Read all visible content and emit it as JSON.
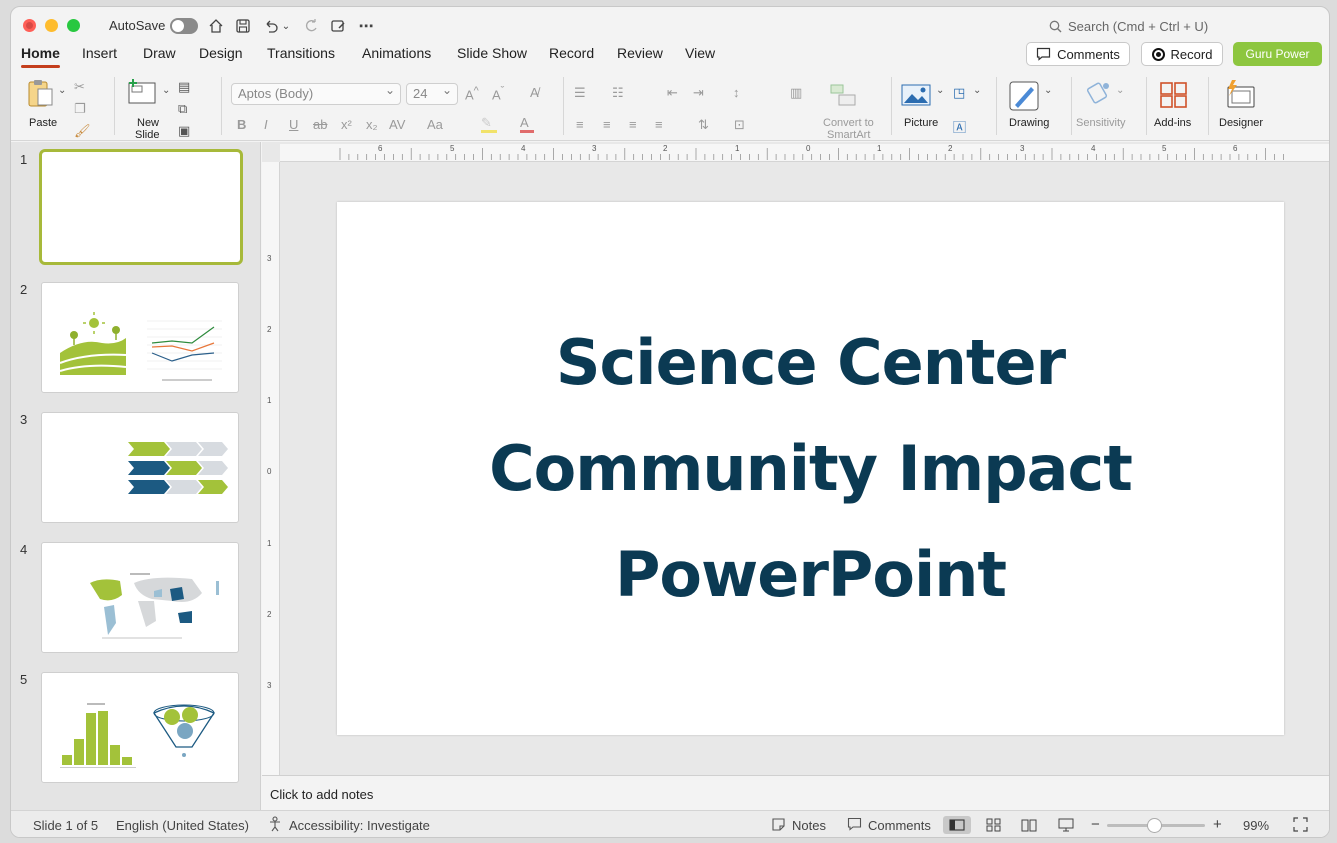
{
  "titlebar": {
    "autosave_label": "AutoSave",
    "search_placeholder": "Search (Cmd + Ctrl + U)"
  },
  "tabs": [
    "Home",
    "Insert",
    "Draw",
    "Design",
    "Transitions",
    "Animations",
    "Slide Show",
    "Record",
    "Review",
    "View"
  ],
  "active_tab": "Home",
  "header_buttons": {
    "comments": "Comments",
    "record": "Record",
    "guru": "Guru Power"
  },
  "ribbon": {
    "paste": "Paste",
    "new_slide_1": "New",
    "new_slide_2": "Slide",
    "font_name": "Aptos (Body)",
    "font_size": "24",
    "convert_1": "Convert to",
    "convert_2": "SmartArt",
    "picture": "Picture",
    "drawing": "Drawing",
    "sensitivity": "Sensitivity",
    "addins": "Add-ins",
    "designer": "Designer"
  },
  "slides_panel": [
    "1",
    "2",
    "3",
    "4",
    "5"
  ],
  "slide": {
    "title_line1": "Science Center",
    "title_line2": "Community Impact",
    "title_line3": "PowerPoint"
  },
  "notes_placeholder": "Click to add notes",
  "status": {
    "slide_info": "Slide 1 of 5",
    "language": "English (United States)",
    "accessibility": "Accessibility: Investigate",
    "notes": "Notes",
    "comments": "Comments",
    "zoom": "99%"
  },
  "ruler": {
    "h": [
      "6",
      "5",
      "4",
      "3",
      "2",
      "1",
      "0",
      "1",
      "2",
      "3",
      "4",
      "5",
      "6"
    ],
    "v": [
      "3",
      "2",
      "1",
      "0",
      "1",
      "2",
      "3"
    ]
  },
  "colors": {
    "accent_tab": "#c43e1c",
    "brand_green": "#8dc63f",
    "title_navy": "#0b3a53",
    "selected_thumb": "#a7b93a"
  }
}
